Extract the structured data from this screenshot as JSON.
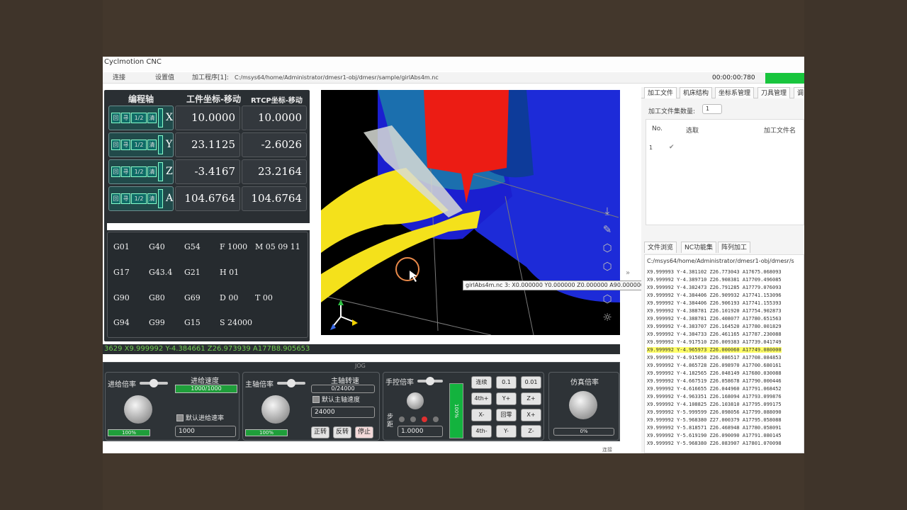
{
  "app": {
    "title": "Cyclmotion CNC",
    "menu": [
      "连接",
      "设置值"
    ],
    "file_label": "加工程序[1]:",
    "file_path": "C:/msys64/home/Administrator/dmesr1-obj/dmesr/sample/girlAbs4m.nc",
    "clock": "00:00:00:780"
  },
  "axes_panel": {
    "headers": [
      "编程轴",
      "工件坐标-移动",
      "RTCP坐标-移动"
    ],
    "ctrl_labels": [
      "回",
      "寻",
      "1/2",
      "清"
    ],
    "rows": [
      {
        "axis": "X",
        "work": "10.0000",
        "rtcp": "10.0000"
      },
      {
        "axis": "Y",
        "work": "23.1125",
        "rtcp": "-2.6026"
      },
      {
        "axis": "Z",
        "work": "-3.4167",
        "rtcp": "23.2164"
      },
      {
        "axis": "A",
        "work": "104.6764",
        "rtcp": "104.6764"
      }
    ]
  },
  "gcode_modal": [
    [
      "G01",
      "G40",
      "G54",
      "F 1000",
      "M 05 09 11"
    ],
    [
      "G17",
      "G43.4",
      "G21",
      "H 01",
      ""
    ],
    [
      "G90",
      "G80",
      "G69",
      "D 00",
      "T 00"
    ],
    [
      "G94",
      "G99",
      "G15",
      "S 24000",
      ""
    ]
  ],
  "tooltip": "girlAbs4m.nc 3:  X0.000000 Y0.000000 Z0.000000 A90.000000",
  "ticker": "3629 X9.999992 Y-4.384661 Z26.973939 A177B8.905653",
  "control": {
    "title": "JOG",
    "feed": {
      "label": "进给倍率",
      "speed_label": "进给速度",
      "speed_value": "1000/1000",
      "default_label": "默认进给速率",
      "default_value": "1000",
      "percent": "100%"
    },
    "spindle": {
      "label": "主轴倍率",
      "speed_label": "主轴转速",
      "speed_value": "0/24000",
      "default_label": "默认主轴速度",
      "default_value": "24000",
      "percent": "100%",
      "cw": "正转",
      "ccw": "反转",
      "stop": "停止"
    },
    "hand": {
      "label": "手控倍率",
      "step_label": "步距",
      "step_value": "1.0000",
      "percent": "100%"
    },
    "jog_buttons": [
      [
        "连续",
        "0.1",
        "0.01"
      ],
      [
        "4th+",
        "Y+",
        "Z+"
      ],
      [
        "X-",
        "回零",
        "X+"
      ],
      [
        "4th-",
        "Y-",
        "Z-"
      ]
    ],
    "sim": {
      "label": "仿真倍率",
      "percent": "0%"
    }
  },
  "right_panel": {
    "tabs": [
      "加工文件",
      "机床结构",
      "坐标系管理",
      "刀具管理",
      "调"
    ],
    "file_count_label": "加工文件集数量:",
    "file_count": "1",
    "table_headers": [
      "No.",
      "选取",
      "加工文件名"
    ],
    "table_row": [
      "1",
      "✔"
    ],
    "browser_tabs": [
      "文件浏览",
      "NC功能集",
      "阵列加工"
    ],
    "browser_path": "C:/msys64/home/Administrator/dmesr1-obj/dmesr/s",
    "code_lines": [
      "X9.999993 Y-4.381102 Z26.773043 A17675.068093",
      "X9.999992 Y-4.389710 Z26.908381 A17709.496085",
      "X9.999992 Y-4.382473 Z26.791285 A17779.076093",
      "X9.999992 Y-4.384406 Z26.909932 A17741.153096",
      "X9.999992 Y-4.384406 Z26.906193 A17741.155393",
      "X9.999992 Y-4.388781 Z26.101920 A17754.902873",
      "X9.999992 Y-4.388781 Z26.408077 A17780.651563",
      "X9.999992 Y-4.383707 Z26.164520 A17780.001829",
      "X9.999992 Y-4.384733 Z26.461165 A17787.230088",
      "X9.999992 Y-4.917510 Z26.009383 A17739.041749",
      "X9.999992 Y-4.965973 Z26.000060 A17749.080000",
      "X9.999992 Y-4.915058 Z26.086517 A17708.084853",
      "X9.999992 Y-4.865728 Z26.098970 A17700.680161",
      "X9.999992 Y-4.182565 Z26.048149 A17680.030088",
      "X9.999992 Y-4.667519 Z26.058678 A17790.000446",
      "X9.999992 Y-4.616655 Z26.044960 A17791.068452",
      "X9.999992 Y-4.963351 Z26.168094 A17793.099876",
      "X9.999992 Y-4.108825 Z26.103810 A17795.099175",
      "X9.999992 Y-5.999599 Z26.098056 A17799.088090",
      "X9.999992 Y-5.968380 Z27.000379 A17795.058088",
      "X9.999992 Y-5.818571 Z26.468948 A17780.058091",
      "X9.999992 Y-5.619190 Z26.090090 A17791.080145",
      "X9.999992 Y-5.968380 Z26.083907 A17801.070098"
    ],
    "highlight_index": 10
  },
  "footer_status": "连接"
}
